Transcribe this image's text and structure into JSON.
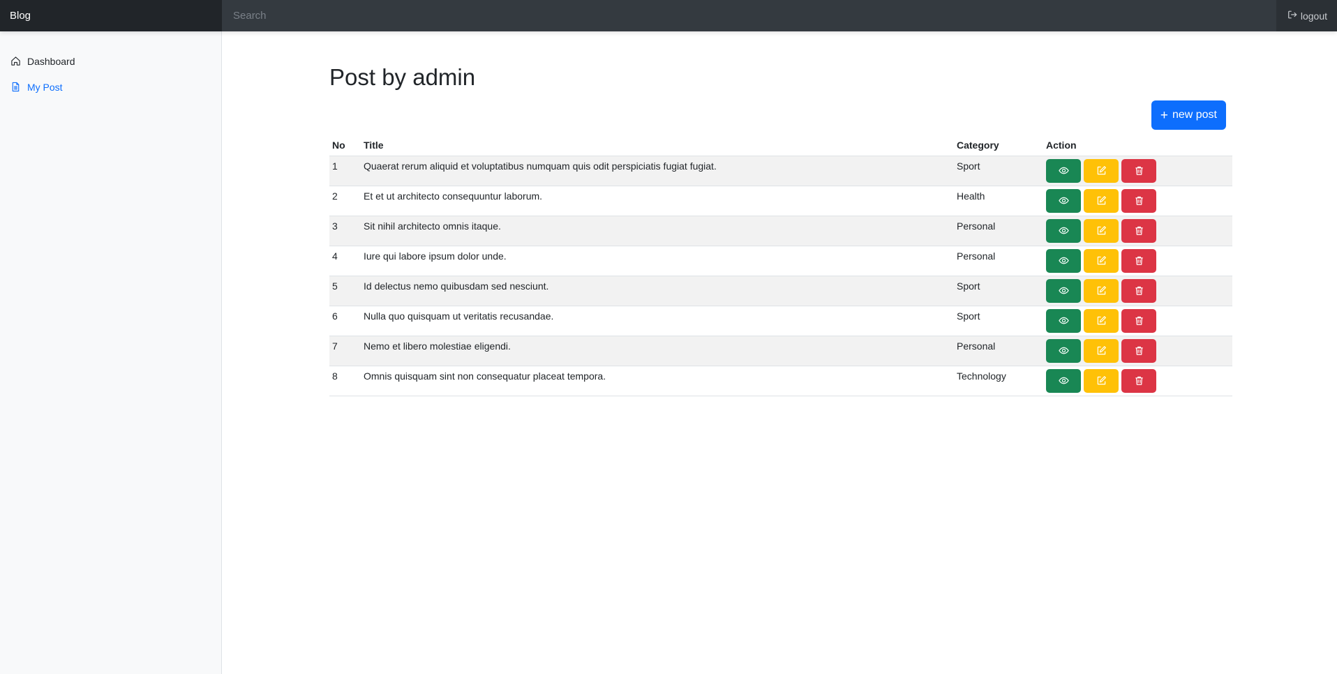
{
  "navbar": {
    "brand": "Blog",
    "search_placeholder": "Search",
    "logout_label": "logout"
  },
  "sidebar": {
    "items": [
      {
        "label": "Dashboard",
        "icon": "home-icon",
        "active": false
      },
      {
        "label": "My Post",
        "icon": "document-icon",
        "active": true
      }
    ]
  },
  "main": {
    "title": "Post by admin",
    "new_post_label": "new post",
    "table": {
      "headers": [
        "No",
        "Title",
        "Category",
        "Action"
      ],
      "rows": [
        {
          "no": "1",
          "title": "Quaerat rerum aliquid et voluptatibus numquam quis odit perspiciatis fugiat fugiat.",
          "category": "Sport"
        },
        {
          "no": "2",
          "title": "Et et ut architecto consequuntur laborum.",
          "category": "Health"
        },
        {
          "no": "3",
          "title": "Sit nihil architecto omnis itaque.",
          "category": "Personal"
        },
        {
          "no": "4",
          "title": "Iure qui labore ipsum dolor unde.",
          "category": "Personal"
        },
        {
          "no": "5",
          "title": "Id delectus nemo quibusdam sed nesciunt.",
          "category": "Sport"
        },
        {
          "no": "6",
          "title": "Nulla quo quisquam ut veritatis recusandae.",
          "category": "Sport"
        },
        {
          "no": "7",
          "title": "Nemo et libero molestiae eligendi.",
          "category": "Personal"
        },
        {
          "no": "8",
          "title": "Omnis quisquam sint non consequatur placeat tempora.",
          "category": "Technology"
        }
      ]
    }
  },
  "colors": {
    "navbar": "#343a40",
    "brand_bg": "#212529",
    "primary": "#0d6efd",
    "view": "#198754",
    "edit": "#ffc107",
    "delete": "#dc3545"
  }
}
